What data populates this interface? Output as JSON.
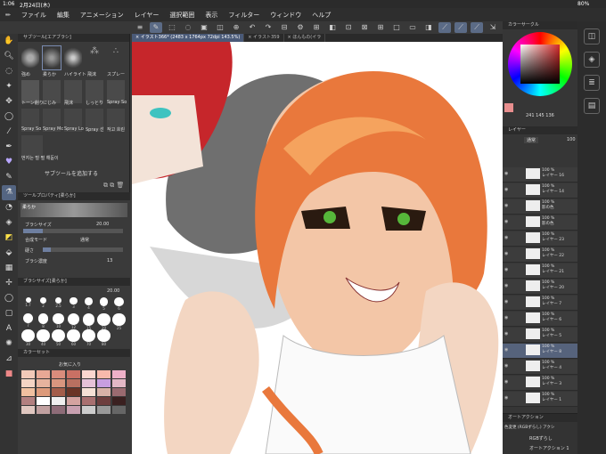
{
  "status": {
    "time": "1:06",
    "date": "2月24日(木)",
    "battery": "80%"
  },
  "menu": [
    "ファイル",
    "編集",
    "アニメーション",
    "レイヤー",
    "選択範囲",
    "表示",
    "フィルター",
    "ウィンドウ",
    "ヘルプ"
  ],
  "tabs": [
    {
      "label": "× イラスト366* (2483 x 1764px 72dpi 143.5%)",
      "active": true
    },
    {
      "label": "× イラスト359",
      "active": false
    },
    {
      "label": "× ほんもの(イラ",
      "active": false
    }
  ],
  "subtool": {
    "title": "サブツール[エアブラシ]",
    "row1": [
      "強め",
      "柔らか",
      "ハイライト",
      "飛沫",
      "スプレー"
    ],
    "row2": [
      "トーン削り",
      "にじみ",
      "飛沫",
      "しっとり",
      "Spray So"
    ],
    "row3": [
      "Spray So",
      "Spray Mc",
      "Spray Lo",
      "Spray 선",
      "작고 흐린"
    ],
    "row4": "번지는 털 펄 해돋이",
    "add": "サブツールを追加する"
  },
  "toolprop": {
    "title": "ツールプロパティ[柔らか]",
    "brush_label": "柔らか",
    "size_label": "ブラシサイズ",
    "size_value": "20.00",
    "blend_label": "合成モード",
    "blend_value": "通常",
    "hardness_label": "硬さ",
    "density_label": "ブラシ濃度",
    "density_value": "13"
  },
  "brushsize": {
    "title": "ブラシサイズ[柔らか]",
    "value": "20.00",
    "sizes": [
      "1.7",
      "2",
      "2.5",
      "3",
      "4",
      "5",
      "6",
      "7",
      "8",
      "10",
      "12",
      "15",
      "20",
      "25",
      "30",
      "40",
      "50",
      "60",
      "70",
      "80"
    ]
  },
  "colorset": {
    "title": "カラーセット",
    "set_name": "お気に入り"
  },
  "color_circle": {
    "title": "カラーサークル",
    "hsv": "241 145 136"
  },
  "layers": {
    "title": "レイヤー",
    "blend": "通常",
    "opacity": "100",
    "items": [
      {
        "pct": "100 %",
        "name": "レイヤー 16"
      },
      {
        "pct": "100 %",
        "name": "レイヤー 14"
      },
      {
        "pct": "100 %",
        "name": "影の色"
      },
      {
        "pct": "100 %",
        "name": "影の色"
      },
      {
        "pct": "100 %",
        "name": "レイヤー 23"
      },
      {
        "pct": "100 %",
        "name": "レイヤー 22"
      },
      {
        "pct": "100 %",
        "name": "レイヤー 21"
      },
      {
        "pct": "100 %",
        "name": "レイヤー 20"
      },
      {
        "pct": "100 %",
        "name": "レイヤー 7"
      },
      {
        "pct": "100 %",
        "name": "レイヤー 6"
      },
      {
        "pct": "100 %",
        "name": "レイヤー 5"
      },
      {
        "pct": "100 %",
        "name": "レイヤー 8"
      },
      {
        "pct": "100 %",
        "name": "レイヤー 4"
      },
      {
        "pct": "100 %",
        "name": "レイヤー 3"
      },
      {
        "pct": "100 %",
        "name": "レイヤー 1"
      }
    ]
  },
  "autoaction": {
    "title": "オートアクション",
    "set": "色変更 (RGBずらし) アクシ",
    "item1": "RGBずらし",
    "item2": "オートアクション 1"
  },
  "colors": {
    "accent": "#56637c",
    "panel": "#3a3a3a",
    "hair": "#e9783c"
  }
}
